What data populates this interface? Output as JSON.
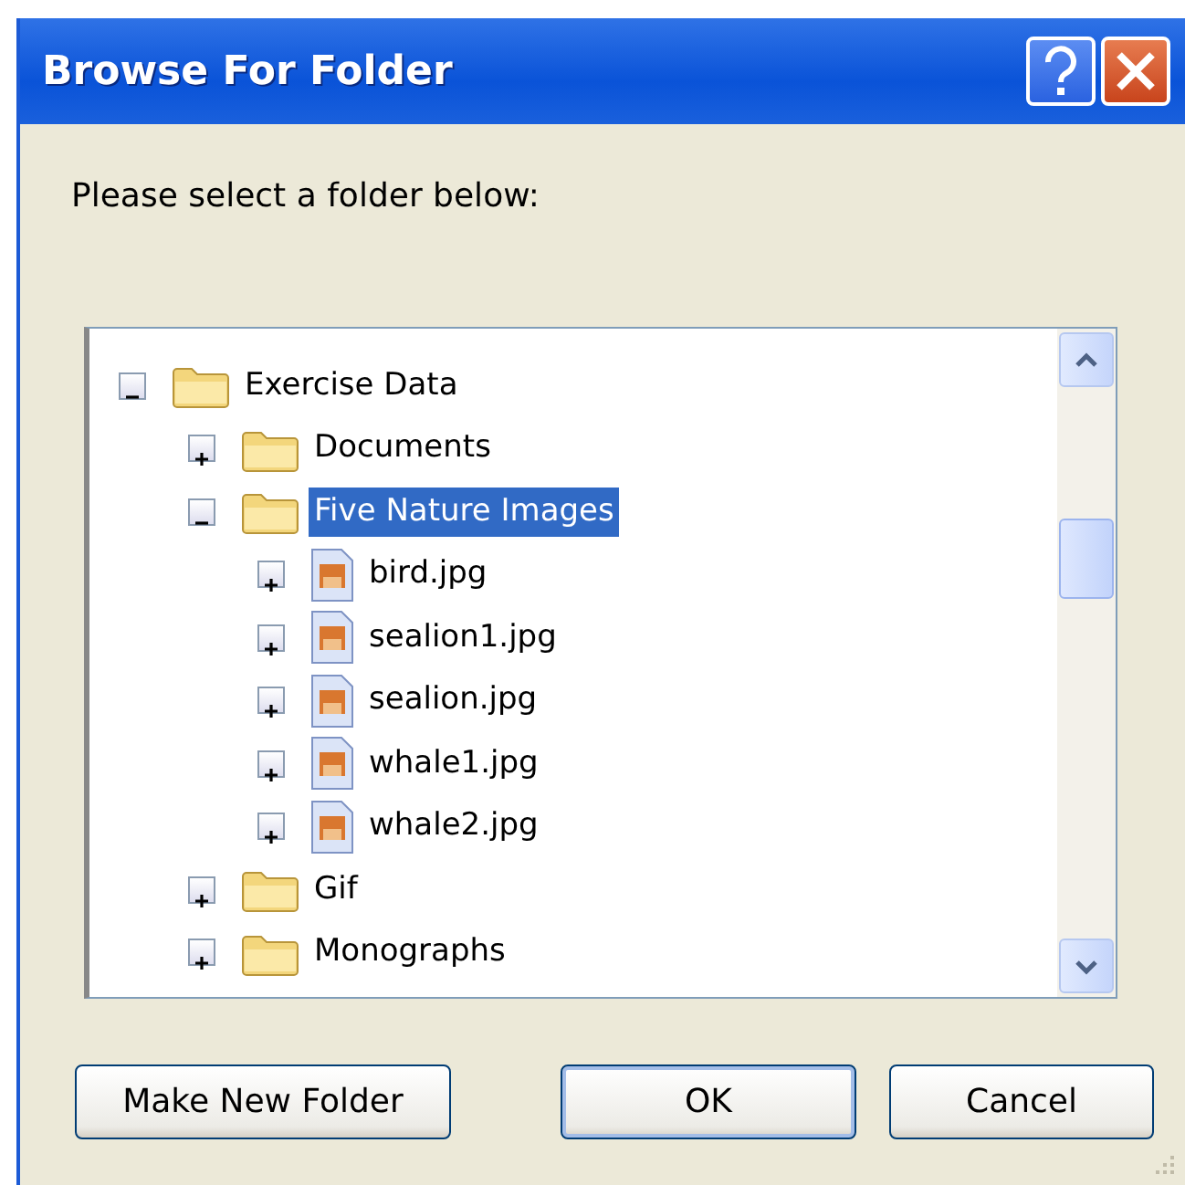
{
  "window": {
    "title": "Browse For Folder"
  },
  "prompt": "Please select a folder below:",
  "tree": [
    {
      "label": "Exercise Data",
      "kind": "folder",
      "expanded": true,
      "selected": false,
      "children": [
        {
          "label": "Documents",
          "kind": "folder",
          "expanded": false,
          "selected": false
        },
        {
          "label": "Five Nature Images",
          "kind": "folder",
          "expanded": true,
          "selected": true,
          "children": [
            {
              "label": "bird.jpg",
              "kind": "image",
              "expanded": false,
              "selected": false
            },
            {
              "label": "sealion1.jpg",
              "kind": "image",
              "expanded": false,
              "selected": false
            },
            {
              "label": "sealion.jpg",
              "kind": "image",
              "expanded": false,
              "selected": false
            },
            {
              "label": "whale1.jpg",
              "kind": "image",
              "expanded": false,
              "selected": false
            },
            {
              "label": "whale2.jpg",
              "kind": "image",
              "expanded": false,
              "selected": false
            }
          ]
        },
        {
          "label": "Gif",
          "kind": "folder",
          "expanded": false,
          "selected": false
        },
        {
          "label": "Monographs",
          "kind": "folder",
          "expanded": false,
          "selected": false
        }
      ]
    }
  ],
  "buttons": [
    {
      "label": "Make New Folder",
      "kind": "normal"
    },
    {
      "label": "OK",
      "kind": "default"
    },
    {
      "label": "Cancel",
      "kind": "normal"
    }
  ]
}
